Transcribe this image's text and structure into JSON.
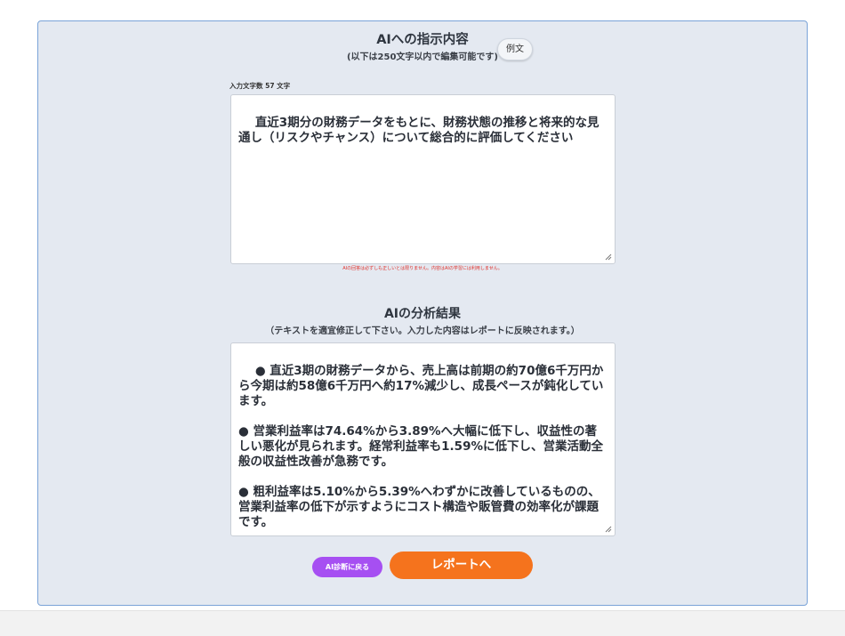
{
  "instruction": {
    "title": "AIへの指示内容",
    "subtitle": "(以下は250文字以内で編集可能です)",
    "example_button": "例文",
    "char_count_label": "入力文字数 57 文字",
    "text": "直近3期分の財務データをもとに、財務状態の推移と将来的な見通し（リスクやチャンス）について総合的に評価してください",
    "disclaimer": "AIの回答は必ずしも正しいとは限りません。内容はAIの学習には利用しません。"
  },
  "result": {
    "title": "AIの分析結果",
    "subtitle": "（テキストを適宜修正して下さい。入力した内容はレポートに反映されます。）",
    "text": "● 直近3期の財務データから、売上高は前期の約70億6千万円から今期は約58億6千万円へ約17%減少し、成長ペースが鈍化しています。\n\n● 営業利益率は74.64%から3.89%へ大幅に低下し、収益性の著しい悪化が見られます。経常利益率も1.59%に低下し、営業活動全般の収益性改善が急務です。\n\n● 粗利益率は5.10%から5.39%へわずかに改善しているものの、営業利益率の低下が示すようにコスト構造や販管費の効率化が課題です。"
  },
  "buttons": {
    "back": "AI診断に戻る",
    "report": "レポートへ"
  },
  "colors": {
    "panel_bg": "#e4e9f1",
    "panel_border": "#7aa3d8",
    "back_button": "#a64ff2",
    "report_button": "#f5731d",
    "notice_text": "#e0302a"
  }
}
